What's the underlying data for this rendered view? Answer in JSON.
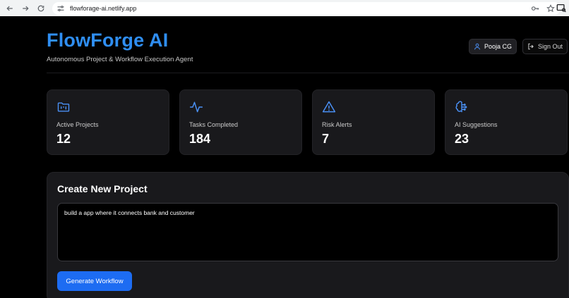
{
  "browser": {
    "url": "flowforage-ai.netlify.app"
  },
  "header": {
    "title": "FlowForge AI",
    "subtitle": "Autonomous Project & Workflow Execution Agent",
    "user_name": "Pooja CG",
    "signout_label": "Sign Out"
  },
  "stats": [
    {
      "label": "Active Projects",
      "value": "12",
      "icon": "folder-kanban-icon"
    },
    {
      "label": "Tasks Completed",
      "value": "184",
      "icon": "activity-icon"
    },
    {
      "label": "Risk Alerts",
      "value": "7",
      "icon": "alert-triangle-icon"
    },
    {
      "label": "AI Suggestions",
      "value": "23",
      "icon": "brain-icon"
    }
  ],
  "create_project": {
    "title": "Create New Project",
    "prompt_value": "build a app where it connects bank and customer",
    "generate_label": "Generate Workflow"
  },
  "colors": {
    "accent": "#2f8ef2",
    "icon_blue": "#4a90f5",
    "button_blue": "#1d6cf2",
    "card_bg": "#19191c",
    "page_bg": "#000000"
  }
}
